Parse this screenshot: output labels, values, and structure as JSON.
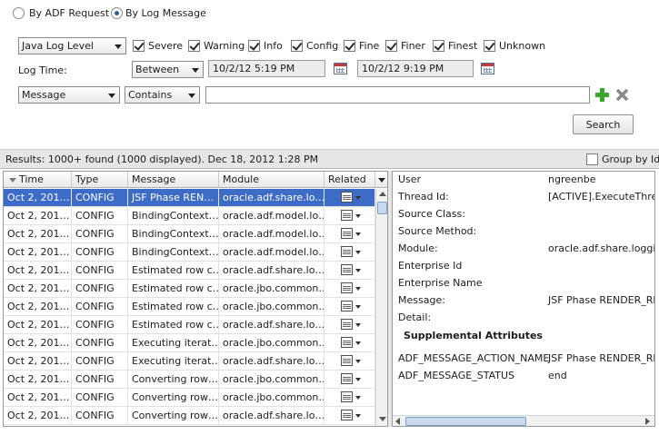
{
  "mode": {
    "options": [
      {
        "label": "By ADF Request",
        "selected": false
      },
      {
        "label": "By Log Message",
        "selected": true
      }
    ]
  },
  "level_select": {
    "value": "Java Log Level"
  },
  "levels": [
    {
      "label": "Severe",
      "checked": true
    },
    {
      "label": "Warning",
      "checked": true
    },
    {
      "label": "Info",
      "checked": true
    },
    {
      "label": "Config",
      "checked": true
    },
    {
      "label": "Fine",
      "checked": true
    },
    {
      "label": "Finer",
      "checked": true
    },
    {
      "label": "Finest",
      "checked": true
    },
    {
      "label": "Unknown",
      "checked": true
    }
  ],
  "log_time": {
    "label": "Log Time:",
    "operator": "Between",
    "from": "10/2/12 5:19 PM",
    "to": "10/2/12 9:19 PM"
  },
  "filter": {
    "field": "Message",
    "operator": "Contains",
    "value": ""
  },
  "search_button": "Search",
  "results": {
    "summary": "Results:  1000+ found (1000 displayed). Dec 18, 2012 1:28 PM",
    "group_by_label": "Group by Id"
  },
  "table": {
    "columns": [
      "Time",
      "Type",
      "Message",
      "Module",
      "Related"
    ],
    "rows": [
      {
        "time": "Oct 2, 201…",
        "type": "CONFIG",
        "message": "JSF Phase REN…",
        "module": "oracle.adf.share.lo…"
      },
      {
        "time": "Oct 2, 201…",
        "type": "CONFIG",
        "message": "BindingContext…",
        "module": "oracle.adf.model.lo…"
      },
      {
        "time": "Oct 2, 201…",
        "type": "CONFIG",
        "message": "BindingContext…",
        "module": "oracle.adf.model.lo…"
      },
      {
        "time": "Oct 2, 201…",
        "type": "CONFIG",
        "message": "BindingContext…",
        "module": "oracle.adf.model.lo…"
      },
      {
        "time": "Oct 2, 201…",
        "type": "CONFIG",
        "message": "Estimated row c…",
        "module": "oracle.adf.share.lo…"
      },
      {
        "time": "Oct 2, 201…",
        "type": "CONFIG",
        "message": "Estimated row c…",
        "module": "oracle.jbo.common…"
      },
      {
        "time": "Oct 2, 201…",
        "type": "CONFIG",
        "message": "Estimated row c…",
        "module": "oracle.jbo.common…"
      },
      {
        "time": "Oct 2, 201…",
        "type": "CONFIG",
        "message": "Estimated row c…",
        "module": "oracle.adf.share.lo…"
      },
      {
        "time": "Oct 2, 201…",
        "type": "CONFIG",
        "message": "Executing iterat…",
        "module": "oracle.jbo.common…"
      },
      {
        "time": "Oct 2, 201…",
        "type": "CONFIG",
        "message": "Executing iterat…",
        "module": "oracle.adf.share.lo…"
      },
      {
        "time": "Oct 2, 201…",
        "type": "CONFIG",
        "message": "Converting row…",
        "module": "oracle.jbo.common…"
      },
      {
        "time": "Oct 2, 201…",
        "type": "CONFIG",
        "message": "Converting row…",
        "module": "oracle.jbo.common…"
      },
      {
        "time": "Oct 2, 201…",
        "type": "CONFIG",
        "message": "Converting row…",
        "module": "oracle.adf.share.lo…"
      }
    ]
  },
  "details": {
    "fields": [
      {
        "label": "User",
        "value": "ngreenbe"
      },
      {
        "label": "Thread Id:",
        "value": "[ACTIVE].ExecuteThread"
      },
      {
        "label": "Source Class:",
        "value": ""
      },
      {
        "label": "Source Method:",
        "value": ""
      },
      {
        "label": "Module:",
        "value": "oracle.adf.share.logging"
      },
      {
        "label": "Enterprise Id",
        "value": ""
      },
      {
        "label": "Enterprise Name",
        "value": ""
      },
      {
        "label": "Message:",
        "value": "JSF Phase RENDER_RES"
      },
      {
        "label": "Detail:",
        "value": ""
      }
    ],
    "supplemental_title": "Supplemental Attributes",
    "supplemental": [
      {
        "label": "ADF_MESSAGE_ACTION_NAME",
        "value": "JSF Phase RENDER_RES"
      },
      {
        "label": "ADF_MESSAGE_STATUS",
        "value": "end"
      }
    ]
  },
  "colors": {
    "selection": "#3d6cc6",
    "add_icon": "#3aa62e",
    "remove_icon": "#8a8a8a",
    "results_bar": "#e6e6e6"
  },
  "icons": [
    "radio-icon",
    "checkbox-icon",
    "calendar-icon",
    "add-icon",
    "remove-icon",
    "related-icon",
    "sort-desc-icon",
    "scroll-arrow-icon"
  ]
}
